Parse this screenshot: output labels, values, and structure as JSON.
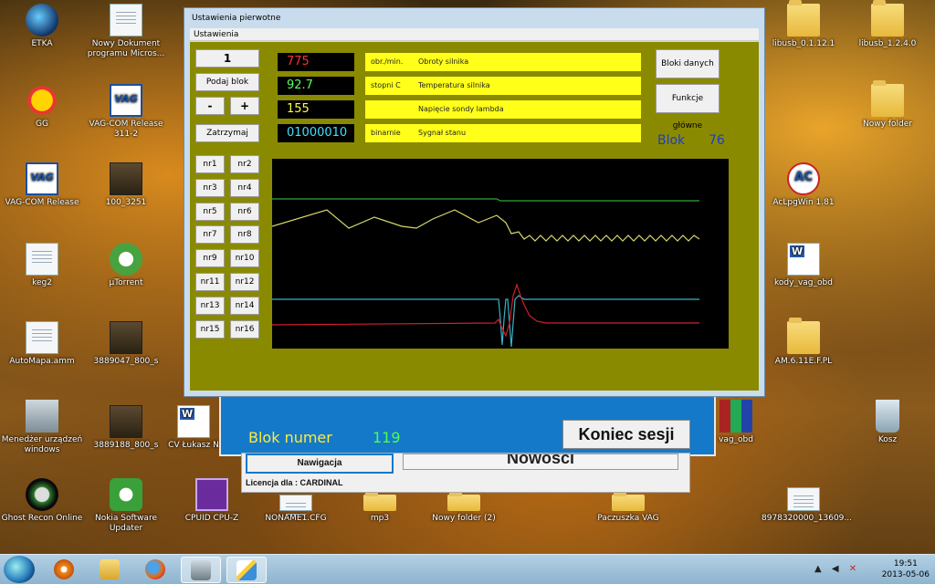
{
  "desktop_icons": [
    {
      "id": "etka",
      "label": "ETKA",
      "icon": "globe-icon"
    },
    {
      "id": "nowy-dokument",
      "label": "Nowy Dokument programu Micros...",
      "icon": "document-icon"
    },
    {
      "id": "gg",
      "label": "GG",
      "icon": "sun-icon"
    },
    {
      "id": "vag-com-311",
      "label": "VAG-COM Release 311-2",
      "icon": "vag-com-icon"
    },
    {
      "id": "vag-com-release",
      "label": "VAG-COM Release",
      "icon": "vag-com-icon"
    },
    {
      "id": "100-3251",
      "label": "100_3251",
      "icon": "photo-icon"
    },
    {
      "id": "keg2",
      "label": "keg2",
      "icon": "document-icon"
    },
    {
      "id": "utorrent",
      "label": "µTorrent",
      "icon": "utorrent-icon"
    },
    {
      "id": "automapa",
      "label": "AutoMapa.amm",
      "icon": "document-icon"
    },
    {
      "id": "3889047",
      "label": "3889047_800_s",
      "icon": "photo-icon"
    },
    {
      "id": "menedzer",
      "label": "Menedżer urządzeń windows",
      "icon": "computer-icon"
    },
    {
      "id": "3889188",
      "label": "3889188_800_s",
      "icon": "photo-icon"
    },
    {
      "id": "cv",
      "label": "CV Łukasz N",
      "icon": "word-icon"
    },
    {
      "id": "ghost-recon",
      "label": "Ghost Recon Online",
      "icon": "skull-icon"
    },
    {
      "id": "nokia",
      "label": "Nokia Software Updater",
      "icon": "update-icon"
    },
    {
      "id": "cpuid",
      "label": "CPUID CPU-Z",
      "icon": "cpu-icon"
    },
    {
      "id": "noname",
      "label": "NONAME1.CFG",
      "icon": "document-icon"
    },
    {
      "id": "mp3",
      "label": "mp3",
      "icon": "folder-icon"
    },
    {
      "id": "nowy-folder-2",
      "label": "Nowy folder (2)",
      "icon": "folder-icon"
    },
    {
      "id": "paczuszka",
      "label": "Paczuszka VAG",
      "icon": "folder-icon"
    },
    {
      "id": "8978320000",
      "label": "8978320000_13609...",
      "icon": "document-icon"
    },
    {
      "id": "libusb-0",
      "label": "libusb_0.1.12.1",
      "icon": "folder-icon"
    },
    {
      "id": "libusb-1",
      "label": "libusb_1.2.4.0",
      "icon": "folder-icon"
    },
    {
      "id": "nowy-folder",
      "label": "Nowy folder",
      "icon": "folder-icon"
    },
    {
      "id": "aclpgwin",
      "label": "AcLpgWin 1.81",
      "icon": "ac-icon"
    },
    {
      "id": "kody-vag",
      "label": "kody_vag_obd",
      "icon": "word-icon"
    },
    {
      "id": "am",
      "label": "AM.6.11E.F.PL",
      "icon": "folder-icon"
    },
    {
      "id": "vag-obd",
      "label": "vag_obd",
      "icon": "winrar-icon"
    },
    {
      "id": "kosz",
      "label": "Kosz",
      "icon": "recycle-bin-icon"
    }
  ],
  "background_window": {
    "blok_numer_label": "Blok numer",
    "blok_numer_value": "119",
    "koniec_sesji": "Koniec sesji",
    "nawigacja": "Nawigacja",
    "partial_text": "Nowości",
    "licencja": "Licencja dla : CARDINAL"
  },
  "dialog": {
    "title": "Ustawienia pierwotne",
    "menu": "Ustawienia",
    "block_input": "1",
    "podaj_blok": "Podaj blok",
    "minus": "-",
    "plus": "+",
    "zatrzymaj": "Zatrzymaj",
    "channels": [
      "nr1",
      "nr2",
      "nr3",
      "nr4",
      "nr5",
      "nr6",
      "nr7",
      "nr8",
      "nr9",
      "nr10",
      "nr11",
      "nr12",
      "nr13",
      "nr14",
      "nr15",
      "nr16"
    ],
    "readings": [
      {
        "value": "775",
        "unit": "obr./min.",
        "name": "Obroty silnika",
        "color": "#ff3030"
      },
      {
        "value": "92.7",
        "unit": "stopni C",
        "name": "Temperatura silnika",
        "color": "#5cff5c"
      },
      {
        "value": "155",
        "unit": "",
        "name": "Napięcie sondy lambda",
        "color": "#ffff40"
      },
      {
        "value": "01000010",
        "unit": "binarnie",
        "name": "Sygnał stanu",
        "color": "#40e0ff"
      }
    ],
    "bloki_danych": "Bloki danych",
    "funkcje_glowne": "Funkcje główne",
    "blok_label": "Blok",
    "blok_value": "76"
  },
  "graph_colors": {
    "green": "#2ea83a",
    "yellow": "#d8d86a",
    "cyan": "#3ab3c8",
    "red": "#d0202a"
  },
  "taskbar": {
    "time": "19:51",
    "date": "2013-05-06",
    "items": [
      "start-button",
      "media-player-icon",
      "explorer-icon",
      "firefox-icon",
      "vag-app-icon",
      "paint-icon"
    ]
  }
}
